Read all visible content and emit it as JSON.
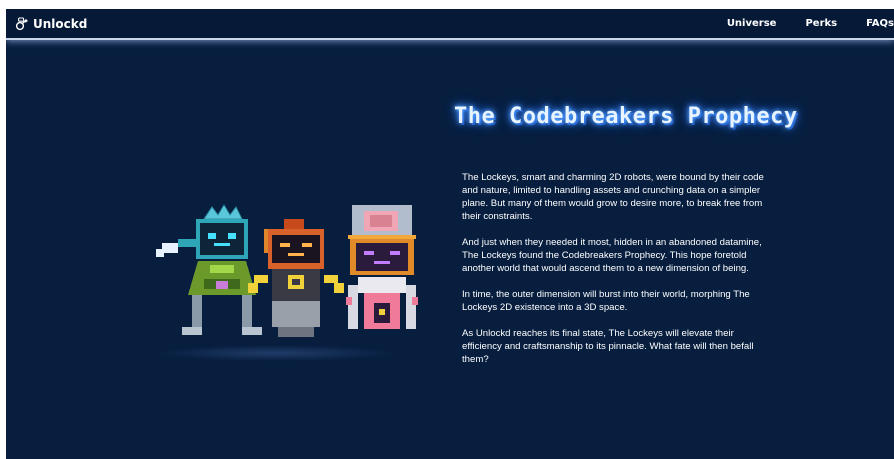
{
  "brand": {
    "name": "Unlockd",
    "icon": "unlockd-logo-icon"
  },
  "nav": {
    "links": [
      {
        "label": "Universe"
      },
      {
        "label": "Perks"
      },
      {
        "label": "FAQs"
      }
    ]
  },
  "hero": {
    "title": "The Codebreakers Prophecy",
    "paragraphs": [
      "The Lockeys, smart and charming 2D robots, were bound by their code and nature, limited to handling assets and crunching data on a simpler plane. But many of them would grow to desire more, to break free from their constraints.",
      "And just when they needed it most, hidden in an abandoned datamine, The Lockeys found the Codebreakers Prophecy. This hope foretold another world that would ascend them to a new dimension of being.",
      "In time, the outer dimension will burst into their world, morphing The Lockeys 2D existence into a 3D space.",
      "As Unlockd reaches its final state, The Lockeys will elevate their efficiency and craftsmanship to its pinnacle. What fate will then befall them?"
    ]
  },
  "colors": {
    "background": "#071e3f",
    "nav_background": "#061a37",
    "title_glow": "#3f8cff",
    "text": "#ffffff"
  },
  "art": {
    "description_icon": "pixel-robots-illustration"
  }
}
